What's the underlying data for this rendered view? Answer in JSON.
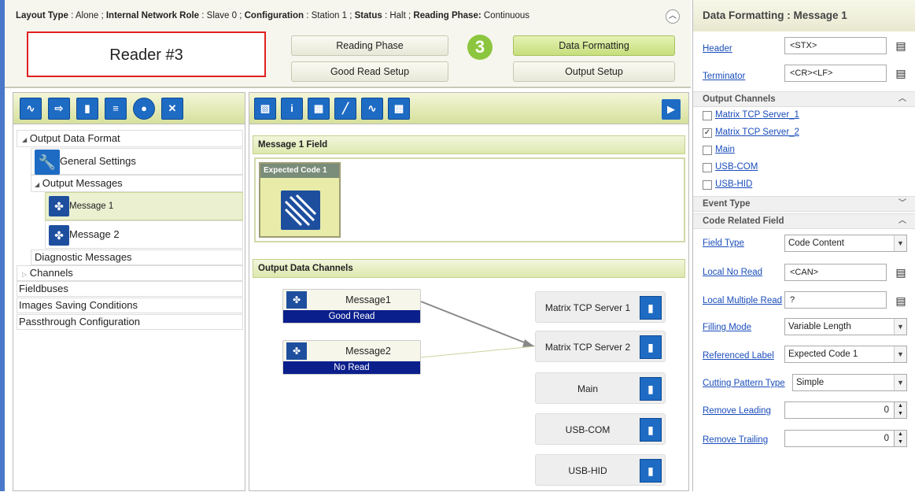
{
  "status": {
    "layout_key": "Layout Type",
    "layout_val": "Alone",
    "role_key": "Internal Network Role",
    "role_val": "Slave 0",
    "config_key": "Configuration",
    "config_val": "Station 1",
    "status_key": "Status",
    "status_val": "Halt",
    "phase_key": "Reading Phase:",
    "phase_val": "Continuous"
  },
  "reader_label": "Reader #3",
  "nav": {
    "reading_phase": "Reading Phase",
    "good_read": "Good Read Setup",
    "data_formatting": "Data Formatting",
    "output_setup": "Output Setup",
    "step": "3"
  },
  "tree": {
    "output_data_format": "Output Data Format",
    "general_settings": "General Settings",
    "output_messages": "Output Messages",
    "message1": "Message 1",
    "message2": "Message 2",
    "diagnostic": "Diagnostic Messages",
    "channels": "Channels",
    "fieldbuses": "Fieldbuses",
    "images_saving": "Images Saving Conditions",
    "passthrough": "Passthrough Configuration"
  },
  "center": {
    "field_title": "Message 1 Field",
    "expected_code": "Expected Code  1",
    "channels_title": "Output Data Channels",
    "nodes": [
      {
        "label": "Message1",
        "sub": "Good Read"
      },
      {
        "label": "Message2",
        "sub": "No Read"
      }
    ],
    "channels": [
      "Matrix TCP Server 1",
      "Matrix TCP Server 2",
      "Main",
      "USB-COM",
      "USB-HID"
    ]
  },
  "right": {
    "title": "Data Formatting : Message 1",
    "header_lbl": "Header",
    "header_val": "<STX>",
    "terminator_lbl": "Terminator",
    "terminator_val": "<CR><LF>",
    "output_channels": "Output Channels",
    "checks": [
      {
        "label": "Matrix TCP Server_1",
        "checked": false
      },
      {
        "label": "Matrix TCP Server_2",
        "checked": true
      },
      {
        "label": "Main",
        "checked": false
      },
      {
        "label": "USB-COM",
        "checked": false
      },
      {
        "label": "USB-HID",
        "checked": false
      }
    ],
    "event_type": "Event Type",
    "code_related": "Code Related Field",
    "field_type_lbl": "Field Type",
    "field_type_val": "Code Content",
    "local_no_read_lbl": "Local No Read",
    "local_no_read_val": "<CAN>",
    "local_multi_lbl": "Local Multiple Read",
    "local_multi_val": "?",
    "filling_lbl": "Filling Mode",
    "filling_val": "Variable Length",
    "ref_label_lbl": "Referenced Label",
    "ref_label_val": "Expected Code  1",
    "cutting_lbl": "Cutting Pattern Type",
    "cutting_val": "Simple",
    "remove_leading_lbl": "Remove Leading",
    "remove_leading_val": "0",
    "remove_trailing_lbl": "Remove Trailing",
    "remove_trailing_val": "0"
  },
  "colors": {
    "accent": "#1e6bc4",
    "step": "#8cc63e",
    "status_bar": "#0b1f8c"
  }
}
